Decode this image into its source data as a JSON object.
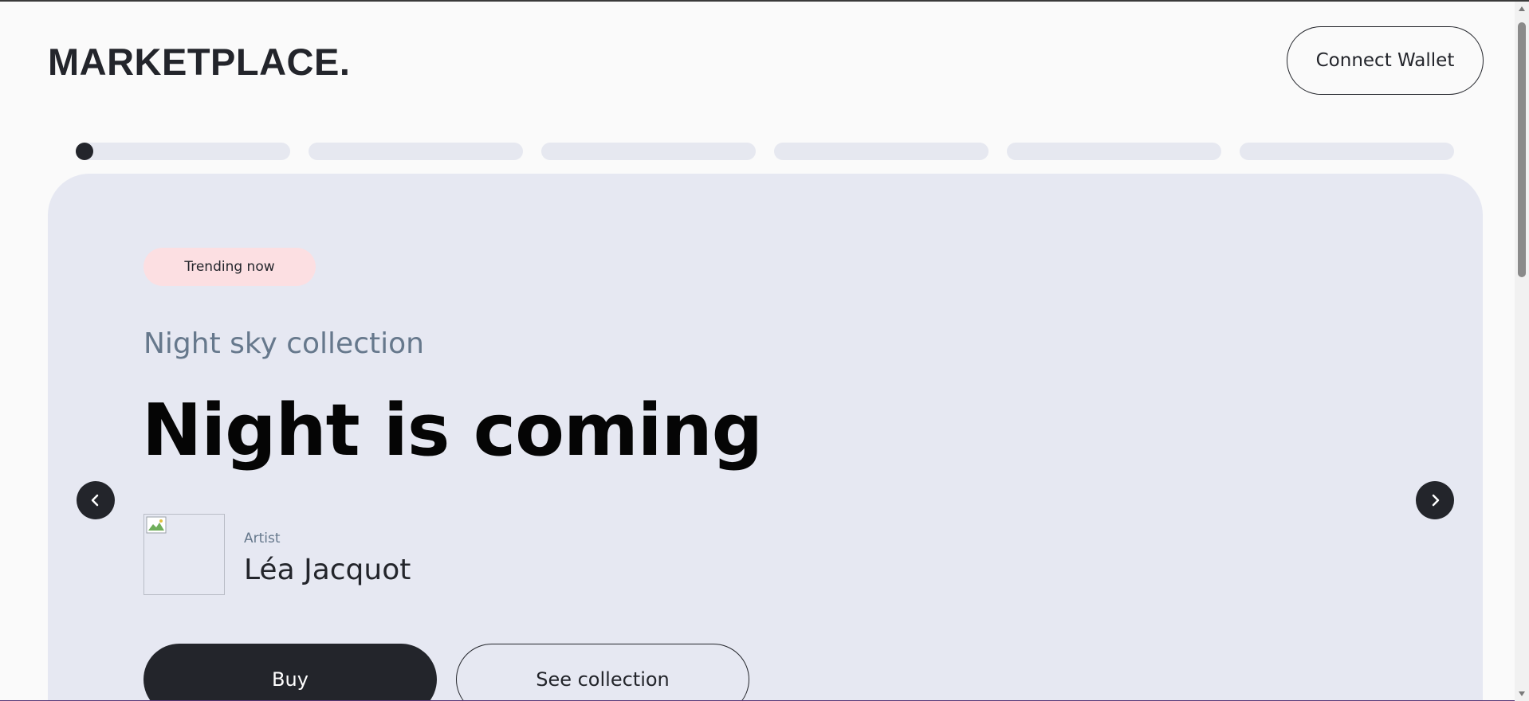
{
  "header": {
    "logo": "MARKETPLACE.",
    "connect_label": "Connect Wallet"
  },
  "carousel": {
    "slide_count": 6,
    "active_index": 0
  },
  "hero": {
    "badge": "Trending now",
    "subtitle": "Night sky collection",
    "title": "Night is coming",
    "artist_label": "Artist",
    "artist_name": "Léa Jacquot",
    "buy_label": "Buy",
    "see_label": "See collection"
  },
  "icons": {
    "prev": "chevron-left-icon",
    "next": "chevron-right-icon",
    "avatar": "broken-image-icon"
  },
  "colors": {
    "dark": "#23252b",
    "hero_bg": "#e6e8f2",
    "badge_bg": "#fcdfe2",
    "muted": "#66788c"
  }
}
